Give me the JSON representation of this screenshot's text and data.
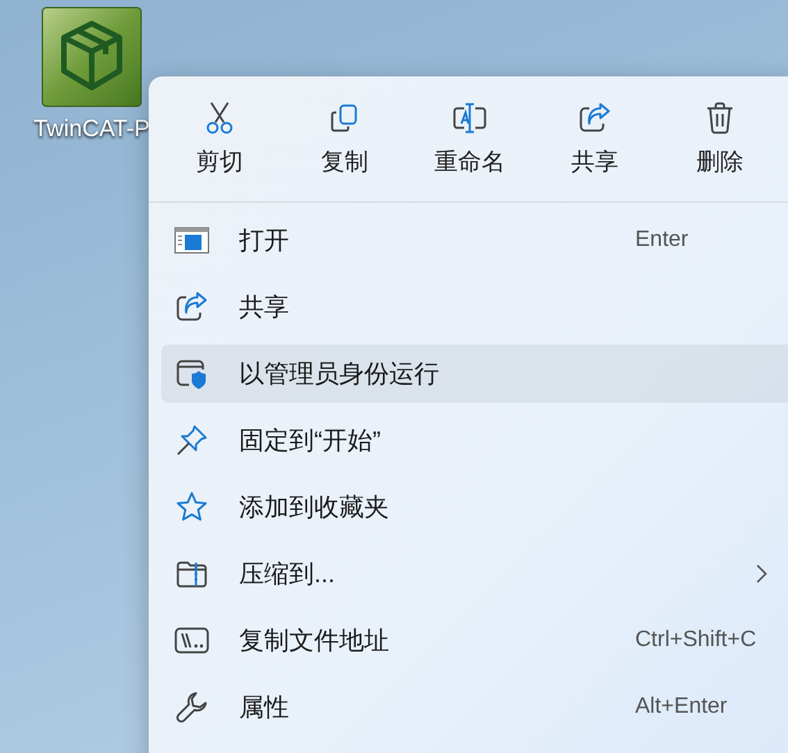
{
  "desktop": {
    "icons": [
      {
        "label": "TwinCAT-P"
      }
    ]
  },
  "context_menu": {
    "toolbar": [
      {
        "kind": "cut",
        "label": "剪切"
      },
      {
        "kind": "copy",
        "label": "复制"
      },
      {
        "kind": "rename",
        "label": "重命名"
      },
      {
        "kind": "share",
        "label": "共享"
      },
      {
        "kind": "delete",
        "label": "删除"
      }
    ],
    "items": [
      {
        "kind": "open",
        "label": "打开",
        "shortcut": "Enter",
        "selected": false,
        "submenu": false
      },
      {
        "kind": "share",
        "label": "共享",
        "selected": false,
        "submenu": false
      },
      {
        "kind": "admin",
        "label": "以管理员身份运行",
        "selected": true,
        "submenu": false
      },
      {
        "kind": "pin",
        "label": "固定到“开始”",
        "selected": false,
        "submenu": false
      },
      {
        "kind": "favorite",
        "label": "添加到收藏夹",
        "selected": false,
        "submenu": false
      },
      {
        "kind": "zip",
        "label": "压缩到...",
        "selected": false,
        "submenu": true
      },
      {
        "kind": "path",
        "label": "复制文件地址",
        "shortcut": "Ctrl+Shift+C",
        "selected": false,
        "submenu": false
      },
      {
        "kind": "properties",
        "label": "属性",
        "shortcut": "Alt+Enter",
        "selected": false,
        "submenu": false
      }
    ]
  }
}
